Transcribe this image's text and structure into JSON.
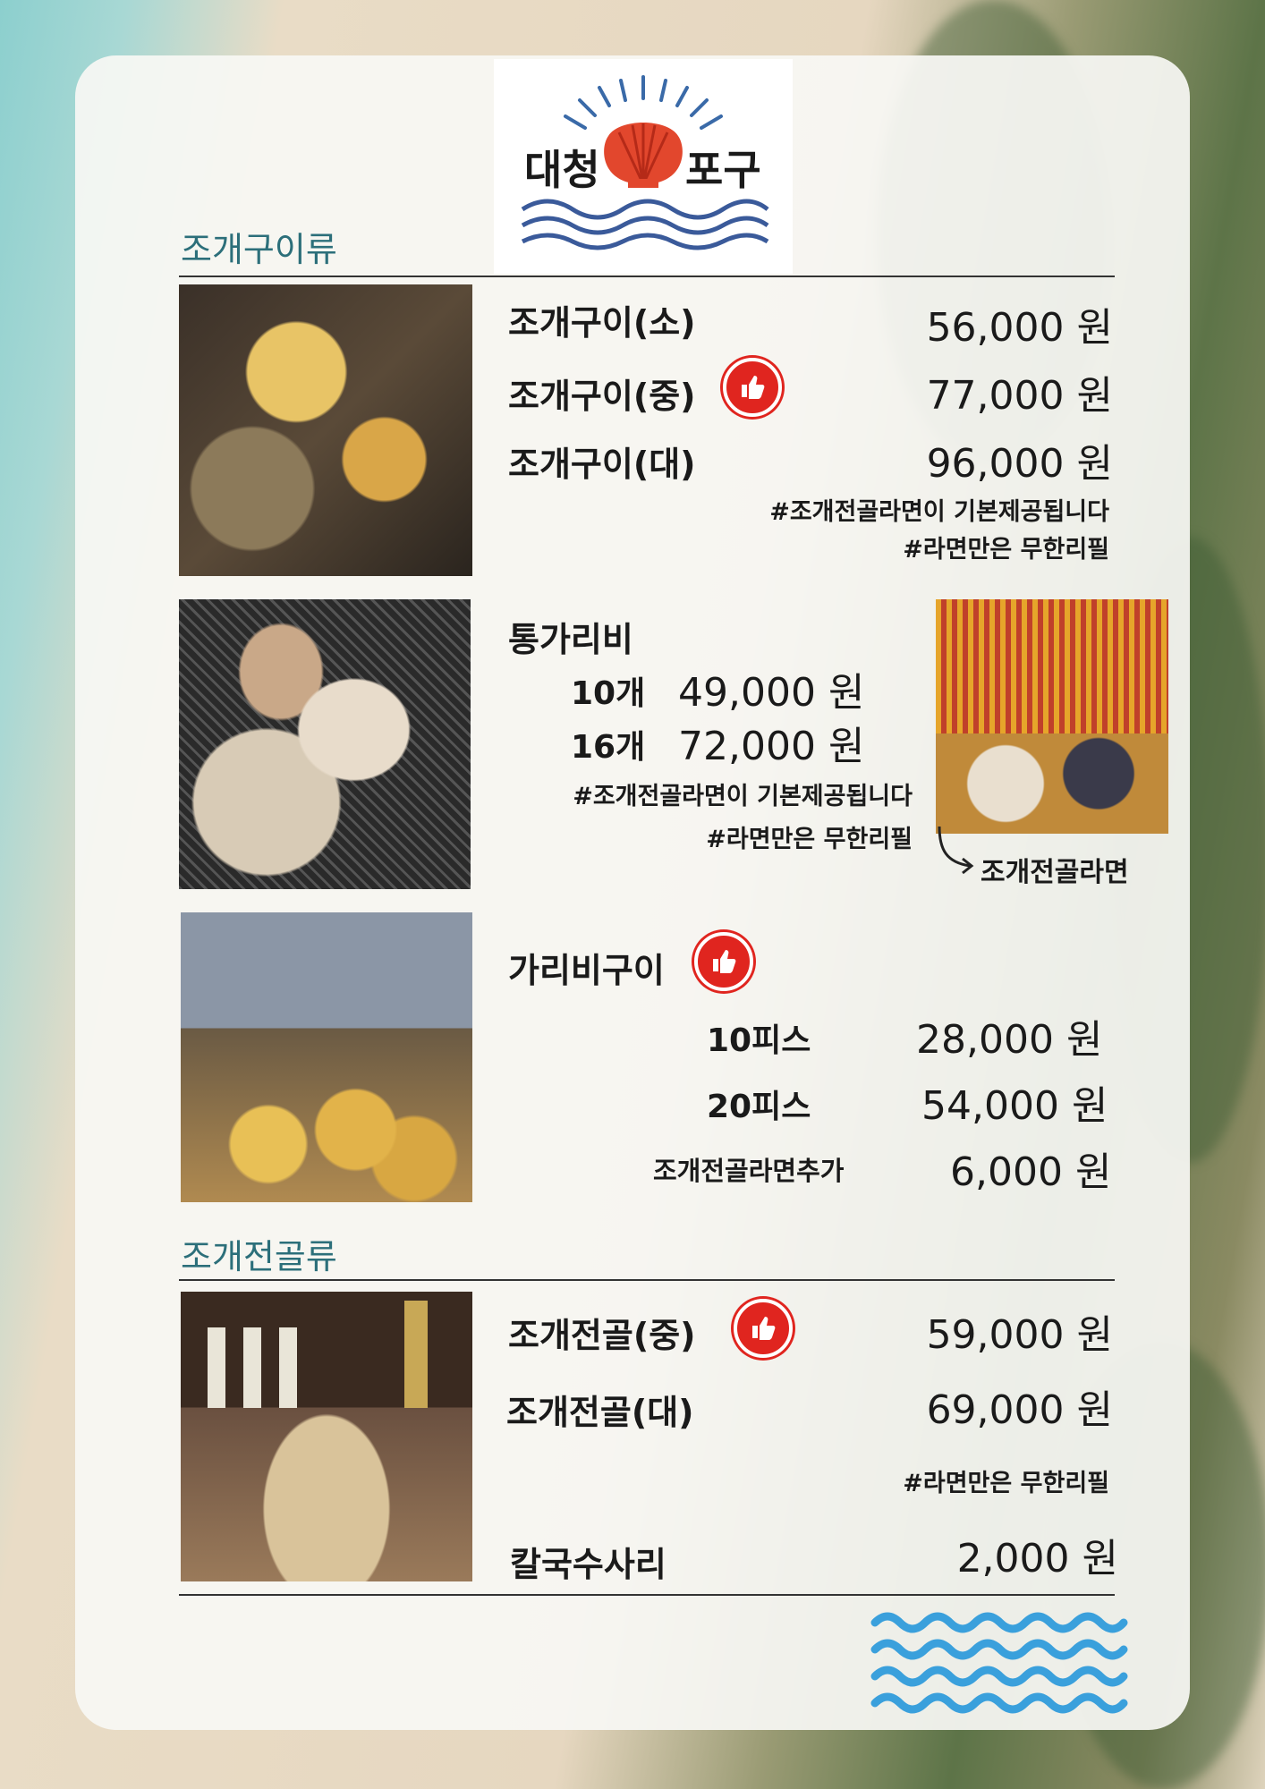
{
  "brand": {
    "name_left": "대청",
    "name_right": "포구"
  },
  "sections": {
    "grill": "조개구이류",
    "stew": "조개전골류"
  },
  "grill_items": [
    {
      "name": "조개구이(소)",
      "price": "56,000 원"
    },
    {
      "name": "조개구이(중)",
      "price": "77,000 원"
    },
    {
      "name": "조개구이(대)",
      "price": "96,000 원"
    }
  ],
  "grill_notes": [
    "#조개전골라면이 기본제공됩니다",
    "#라면만은 무한리필"
  ],
  "scallop": {
    "title": "통가리비",
    "rows": [
      {
        "qty": "10개",
        "price": "49,000 원"
      },
      {
        "qty": "16개",
        "price": "72,000 원"
      }
    ],
    "notes": [
      "#조개전골라면이 기본제공됩니다",
      "#라면만은 무한리필"
    ],
    "side_label": "조개전골라면"
  },
  "scallop_grill": {
    "title": "가리비구이",
    "rows": [
      {
        "qty": "10피스",
        "price": "28,000 원"
      },
      {
        "qty": "20피스",
        "price": "54,000 원"
      }
    ],
    "extra": {
      "name": "조개전골라면추가",
      "price": "6,000 원"
    }
  },
  "stew_items": [
    {
      "name": "조개전골(중)",
      "price": "59,000 원"
    },
    {
      "name": "조개전골(대)",
      "price": "69,000 원"
    }
  ],
  "stew_note": "#라면만은 무한리필",
  "noodle": {
    "name": "칼국수사리",
    "price": "2,000 원"
  },
  "colors": {
    "accent": "#2c6f7a",
    "recommend": "#e0251f",
    "wave": "#3aa0dc",
    "logo_wave": "#3a5a9a"
  },
  "icons": [
    "thumbs-up-icon",
    "scallop-logo-icon",
    "wave-decoration-icon",
    "arrow-icon"
  ]
}
